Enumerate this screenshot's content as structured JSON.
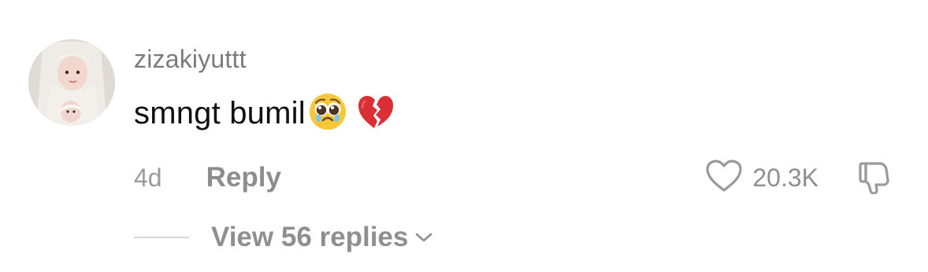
{
  "comment": {
    "username": "zizakiyuttt",
    "text": "smngt bumil",
    "emojis": [
      "pleading-face",
      "broken-heart"
    ],
    "timestamp": "4d",
    "reply_label": "Reply",
    "like_count": "20.3K",
    "view_replies_label": "View 56 replies"
  },
  "colors": {
    "username": "#7b7b7b",
    "comment_text": "#111111",
    "secondary": "#8f8f8f",
    "divider": "#d8d8d8",
    "background": "#ffffff"
  }
}
